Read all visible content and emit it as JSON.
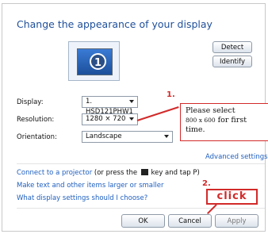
{
  "window": {
    "title": "Change the appearance of your display"
  },
  "monitor": {
    "number": "1"
  },
  "buttons": {
    "detect": "Detect",
    "identify": "Identify",
    "ok": "OK",
    "cancel": "Cancel",
    "apply": "Apply"
  },
  "fields": {
    "display_label": "Display:",
    "display_value": "1. HSD121PHW1",
    "resolution_label": "Resolution:",
    "resolution_value": "1280 × 720",
    "orientation_label": "Orientation:",
    "orientation_value": "Landscape"
  },
  "links": {
    "advanced": "Advanced settings",
    "projector_link": "Connect to a projector",
    "projector_rest": "(or press the",
    "projector_tail": "key and tap P)",
    "larger": "Make text and other items larger or smaller",
    "what": "What display settings should I choose?"
  },
  "annotations": {
    "step1": "1.",
    "step2": "2.",
    "callout_line1": "Please select",
    "callout_res": "800 x 600",
    "callout_tail": "for first",
    "callout_line3": "time.",
    "click": "click",
    "accent_color": "#d22a2a"
  },
  "icons": {
    "windows_key": "windows-key-icon",
    "chevron": "chevron-down-icon",
    "monitor": "monitor-icon"
  }
}
